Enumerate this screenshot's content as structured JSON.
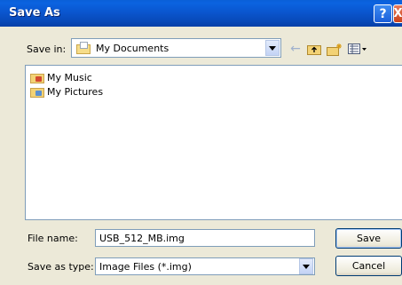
{
  "window": {
    "title": "Save As",
    "help_glyph": "?",
    "close_glyph": "X"
  },
  "toolbar": {
    "save_in_label": "Save in:",
    "save_in_value": "My Documents",
    "icons": [
      "back-arrow-icon",
      "up-one-level-icon",
      "new-folder-icon",
      "view-menu-icon"
    ]
  },
  "files": [
    {
      "name": "My Music",
      "icon": "music-folder-icon"
    },
    {
      "name": "My Pictures",
      "icon": "pictures-folder-icon"
    }
  ],
  "form": {
    "file_name_label": "File name:",
    "file_name_value": "USB_512_MB.img",
    "save_type_label": "Save as type:",
    "save_type_value": "Image Files (*.img)"
  },
  "buttons": {
    "save": "Save",
    "cancel": "Cancel"
  },
  "colors": {
    "titlebar": "#0a56cf",
    "dialog_bg": "#ece9d8",
    "field_border": "#7f9db9"
  }
}
